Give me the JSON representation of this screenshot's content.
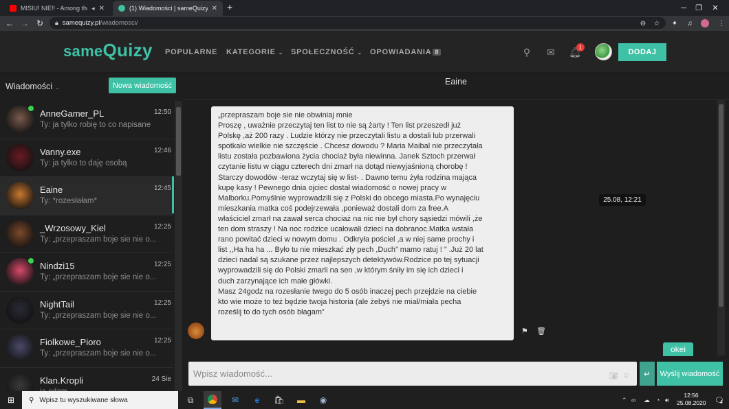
{
  "browser": {
    "tabs": [
      {
        "title": "MISIU! NIE!! - Among the Sle",
        "icon": "youtube-icon"
      },
      {
        "title": "(1) Wiadomości | sameQuizy",
        "icon": "samequizy-icon"
      }
    ],
    "new_tab": "+",
    "url_host": "samequizy.pl",
    "url_path": "/wiadomosci/"
  },
  "site": {
    "logo_same": "same",
    "logo_quizy": "Quizy",
    "nav": [
      {
        "label": "POPULARNE"
      },
      {
        "label": "KATEGORIE",
        "chevron": true
      },
      {
        "label": "SPOŁECZNOŚĆ",
        "chevron": true
      },
      {
        "label": "OPOWIADANIA",
        "badge": "8"
      }
    ],
    "notification_count": "1",
    "add_button": "DODAJ"
  },
  "sidebar": {
    "title": "Wiadomości",
    "new_message": "Nowa wiadomość",
    "conversations": [
      {
        "name": "AnneGamer_PL",
        "preview": "Ty: ja tylko robię to co napisane",
        "time": "12:50",
        "online": true,
        "color": "#7a5a4c"
      },
      {
        "name": "Vanny.exe",
        "preview": "Ty: ja tylko to daję osobą",
        "time": "12:46",
        "online": false,
        "color": "#6a1a24"
      },
      {
        "name": "Eaine",
        "preview": "Ty: *rozesłałam*",
        "time": "12:45",
        "online": false,
        "selected": true,
        "color": "#c9782e"
      },
      {
        "name": "_Wrzosowy_Kiel",
        "preview": "Ty: „przepraszam boje sie nie o...",
        "time": "12:25",
        "online": false,
        "color": "#7b4a2a"
      },
      {
        "name": "Nindzi15",
        "preview": "Ty: „przepraszam boje sie nie o...",
        "time": "12:25",
        "online": true,
        "color": "#d84a6a"
      },
      {
        "name": "NightTail",
        "preview": "Ty: „przepraszam boje sie nie o...",
        "time": "12:25",
        "online": false,
        "color": "#2a2a35"
      },
      {
        "name": "Fiolkowe_Pioro",
        "preview": "Ty: „przepraszam boje sie nie o...",
        "time": "12:25",
        "online": false,
        "color": "#4a4a6a"
      },
      {
        "name": "Klan.Kropli",
        "preview": "ja cdam",
        "time": "24 Sie",
        "online": false,
        "color": "#3a3a3a"
      }
    ]
  },
  "chat": {
    "partner": "Eaine",
    "message_lines": [
      "„przepraszam boje sie nie obwiniaj mnie",
      "Proszę , uważnie przeczytaj ten list to nie są żarty ! Ten list przeszedł już",
      "Polskę ,aż 200 razy . Ludzie którzy nie przeczytali listu a dostali lub przerwali",
      "spotkało wielkie nie szczęście . Chcesz dowodu ? Maria Maibal nie przeczytała",
      "listu została pozbawiona życia chociaż była niewinna. Janek Sztoch przerwał",
      "czytanie listu w ciągu czterech dni zmarł na dotąd niewyjaśnioną chorobę !",
      "Starczy dowodów -teraz wczytaj się w list- . Dawno temu żyła rodzina mająca",
      "kupę kasy ! Pewnego dnia ojciec dostał wiadomość o nowej pracy w",
      "Malborku.Pomyślnie wyprowadzili się z Polski do obcego miasta.Po wynajęciu",
      "mieszkania matka coś podejrzewała ,ponieważ dostali dom za free.A",
      "właściciel zmarł na zawał serca chociaż na nic nie był chory sąsiedzi mówili ,że",
      "ten dom straszy ! Na noc rodzice ucałowali dzieci na dobranoc.Matka wstała",
      "rano powitać dzieci w nowym domu . Odkryła pościel ,a w niej same prochy i",
      "list ,,Ha ha ha ... Było tu nie mieszkać zły pech ,Duch” mamo ratuj ! ” .Już 20 lat",
      "dzieci nadal są szukane przez najlepszych detektywów.Rodzice po tej sytuacji",
      "wyprowadzili się do Polski zmarli na sen ,w którym śniły im się ich dzieci i",
      "duch zarzynające ich małe główki.",
      "Masz 24godz na rozesłanie twego do 5 osób inaczej pech przejdzie na ciebie",
      "kto wie może to też będzie twoja historia (ale żebyś nie miał/miała pecha",
      "roześlij to do tych osób błagam”"
    ],
    "timestamp": "25.08, 12:21",
    "reply": "okei",
    "input_placeholder": "Wpisz wiadomość...",
    "send_label": "Wyślij wiadomość"
  },
  "taskbar": {
    "search_placeholder": "Wpisz tu wyszukiwane słowa",
    "time": "12:56",
    "date": "25.08.2020",
    "notifications": "4"
  }
}
